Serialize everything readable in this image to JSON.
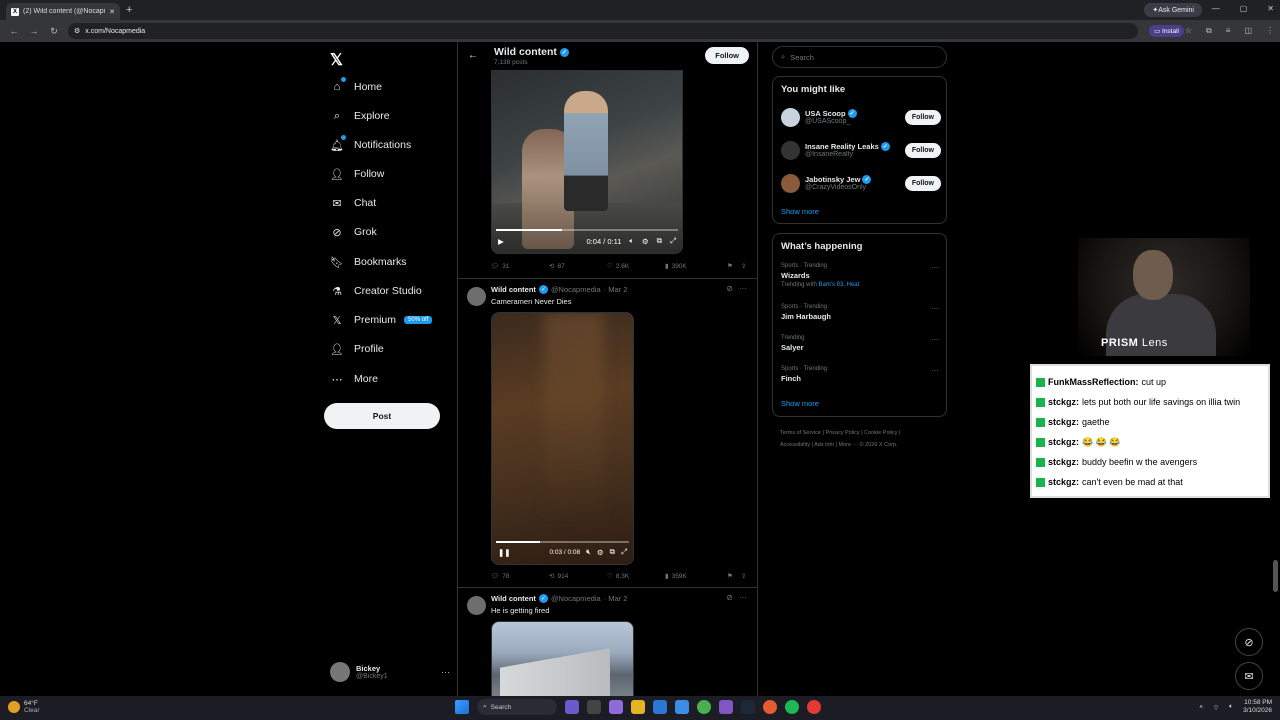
{
  "browser": {
    "tab_title": "(2) Wild content (@Nocapmedia",
    "tab_favicon": "X",
    "url": "x.com/Nocapmedia",
    "ask_gemini": "Ask Gemini",
    "install": "Install"
  },
  "nav": {
    "items": [
      {
        "label": "Home",
        "icon": "home-icon"
      },
      {
        "label": "Explore",
        "icon": "search-icon"
      },
      {
        "label": "Notifications",
        "icon": "bell-icon"
      },
      {
        "label": "Follow",
        "icon": "person-plus-icon"
      },
      {
        "label": "Chat",
        "icon": "mail-icon"
      },
      {
        "label": "Grok",
        "icon": "grok-icon"
      },
      {
        "label": "Bookmarks",
        "icon": "bookmark-icon"
      },
      {
        "label": "Creator Studio",
        "icon": "flask-icon"
      },
      {
        "label": "Premium",
        "icon": "x-icon"
      },
      {
        "label": "Profile",
        "icon": "person-icon"
      },
      {
        "label": "More",
        "icon": "more-circle-icon"
      }
    ],
    "premium_badge": "50% off",
    "post_label": "Post",
    "account_name": "Bickey",
    "account_handle": "@Bickey1"
  },
  "profile_header": {
    "name": "Wild content",
    "posts": "7,138 posts",
    "follow": "Follow"
  },
  "tweets": [
    {
      "video_time": "0:04 / 0:11",
      "video_progress": 0.36,
      "replies": "31",
      "reposts": "87",
      "likes": "2.6K",
      "views": "390K"
    },
    {
      "name": "Wild content",
      "handle": "@Nocapmedia",
      "date": "· Mar 2",
      "text": "Cameramen Never Dies",
      "video_time": "0:03 / 0:08",
      "video_progress": 0.33,
      "replies": "78",
      "reposts": "914",
      "likes": "8.3K",
      "views": "359K"
    },
    {
      "name": "Wild content",
      "handle": "@Nocapmedia",
      "date": "· Mar 2",
      "text": "He is getting fired"
    }
  ],
  "sidebar": {
    "search_placeholder": "Search",
    "you_might_like": "You might like",
    "suggestions": [
      {
        "name": "USA Scoop",
        "handle": "@USAScoop_",
        "follow": "Follow"
      },
      {
        "name": "Insane Reality Leaks",
        "handle": "@InsaneRealty",
        "follow": "Follow"
      },
      {
        "name": "Jabotinsky Jew",
        "handle": "@CrazyVideosOnly",
        "follow": "Follow"
      }
    ],
    "show_more": "Show more",
    "whats_happening": "What’s happening",
    "trends": [
      {
        "meta": "Sports · Trending",
        "title": "Wizards",
        "with_prefix": "Trending with ",
        "with": "Bam's 83, Heat"
      },
      {
        "meta": "Sports · Trending",
        "title": "Jim Harbaugh"
      },
      {
        "meta": "Trending",
        "title": "Salyer"
      },
      {
        "meta": "Sports · Trending",
        "title": "Finch"
      }
    ],
    "show_more_2": "Show more",
    "footer_line1": "Terms of Service  |  Privacy Policy  |  Cookie Policy  |",
    "footer_line2": "Accessibility  |  Ads info  |  More ···  © 2026 X Corp."
  },
  "stream": {
    "prism_bold": "PRISM",
    "prism_rest": " Lens",
    "chat": [
      {
        "user": "FunkMassReflection:",
        "msg": "cut up"
      },
      {
        "user": "stckgz:",
        "msg": "lets put both our life savings on illia twin"
      },
      {
        "user": "stckgz:",
        "msg": "gaethe"
      },
      {
        "user": "stckgz:",
        "msg": "😂 😂 😂"
      },
      {
        "user": "stckgz:",
        "msg": "buddy beefin w the avengers"
      },
      {
        "user": "stckgz:",
        "msg": "can't even be mad at that"
      }
    ]
  },
  "taskbar": {
    "temp": "64°F",
    "weather": "Clear",
    "search": "Search",
    "time": "10:58 PM",
    "date": "3/10/2026"
  },
  "colors": {
    "accent": "#1d9bf0",
    "background": "#000000",
    "border": "#2f3336"
  }
}
